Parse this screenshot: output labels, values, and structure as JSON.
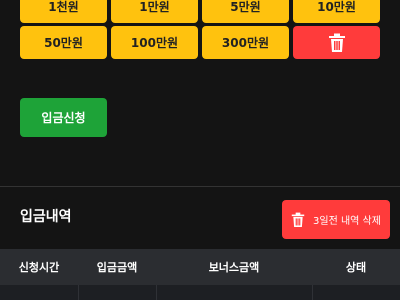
{
  "amount_buttons": [
    "1천원",
    "1만원",
    "5만원",
    "10만원",
    "50만원",
    "100만원",
    "300만원"
  ],
  "delete_icon_name": "trash-icon",
  "deposit_request_label": "입금신청",
  "history": {
    "title": "입금내역",
    "clear_label": "3일전 내역 삭제",
    "clear_icon_name": "trash-icon",
    "columns": [
      "신청시간",
      "입금금액",
      "보너스금액",
      "상태"
    ]
  },
  "colors": {
    "amount_bg": "#ffc20e",
    "danger": "#ff3b3b",
    "success": "#1ea338",
    "background": "#141414",
    "table_header": "#2b2d31"
  }
}
